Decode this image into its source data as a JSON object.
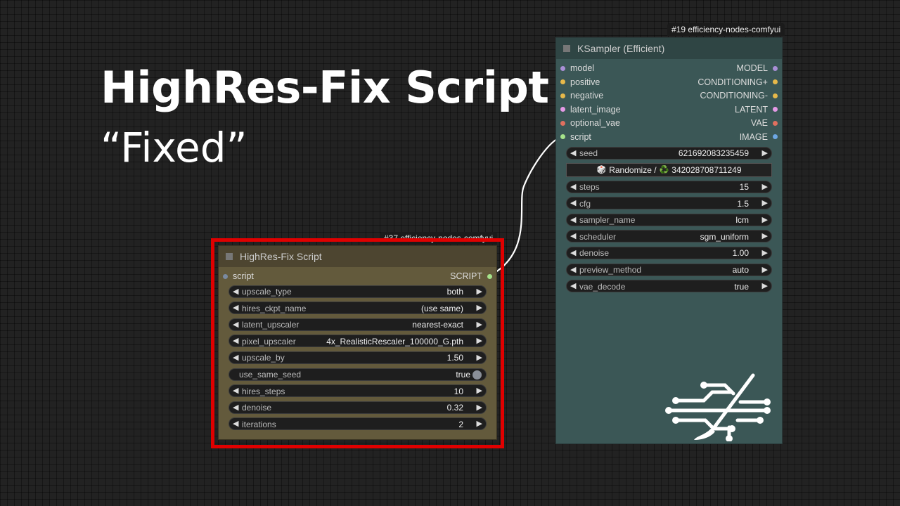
{
  "title": "HighRes-Fix Script",
  "subtitle": "“Fixed”",
  "colors": {
    "background": "#222222",
    "ksampler_body": "#3b5756",
    "hires_body": "#635a3c",
    "highlight_border": "#e00000"
  },
  "ksampler": {
    "badge": "#19 efficiency-nodes-comfyui",
    "title": "KSampler (Efficient)",
    "inputs": [
      {
        "name": "model",
        "color": "#a98fd6"
      },
      {
        "name": "positive",
        "color": "#e7b94a"
      },
      {
        "name": "negative",
        "color": "#e7b94a"
      },
      {
        "name": "latent_image",
        "color": "#e59ae7"
      },
      {
        "name": "optional_vae",
        "color": "#e0705f"
      },
      {
        "name": "script",
        "color": "#a6e38b"
      }
    ],
    "outputs": [
      {
        "name": "MODEL",
        "color": "#a98fd6"
      },
      {
        "name": "CONDITIONING+",
        "color": "#e7b94a"
      },
      {
        "name": "CONDITIONING-",
        "color": "#e7b94a"
      },
      {
        "name": "LATENT",
        "color": "#e59ae7"
      },
      {
        "name": "VAE",
        "color": "#e0705f"
      },
      {
        "name": "IMAGE",
        "color": "#6da7e3"
      }
    ],
    "seed": {
      "label": "seed",
      "value": "621692083235459"
    },
    "randomize": {
      "label": "Randomize /",
      "value": "342028708711249",
      "dice_icon": "🎲",
      "recycle_icon": "♻️"
    },
    "widgets": [
      {
        "label": "steps",
        "value": "15"
      },
      {
        "label": "cfg",
        "value": "1.5"
      },
      {
        "label": "sampler_name",
        "value": "lcm"
      },
      {
        "label": "scheduler",
        "value": "sgm_uniform"
      },
      {
        "label": "denoise",
        "value": "1.00"
      },
      {
        "label": "preview_method",
        "value": "auto"
      },
      {
        "label": "vae_decode",
        "value": "true"
      }
    ]
  },
  "hires": {
    "badge": "#37 efficiency-nodes-comfyui",
    "title": "HighRes-Fix Script",
    "input": {
      "name": "script",
      "color": "#7a8aa0"
    },
    "output": {
      "name": "SCRIPT",
      "color": "#a6e38b"
    },
    "widgets": [
      {
        "label": "upscale_type",
        "value": "both"
      },
      {
        "label": "hires_ckpt_name",
        "value": "(use same)"
      },
      {
        "label": "latent_upscaler",
        "value": "nearest-exact"
      },
      {
        "label": "pixel_upscaler",
        "value": "4x_RealisticRescaler_100000_G.pth"
      },
      {
        "label": "upscale_by",
        "value": "1.50"
      }
    ],
    "toggle": {
      "label": "use_same_seed",
      "value": "true"
    },
    "widgets2": [
      {
        "label": "hires_steps",
        "value": "10"
      },
      {
        "label": "denoise",
        "value": "0.32"
      },
      {
        "label": "iterations",
        "value": "2"
      }
    ]
  }
}
